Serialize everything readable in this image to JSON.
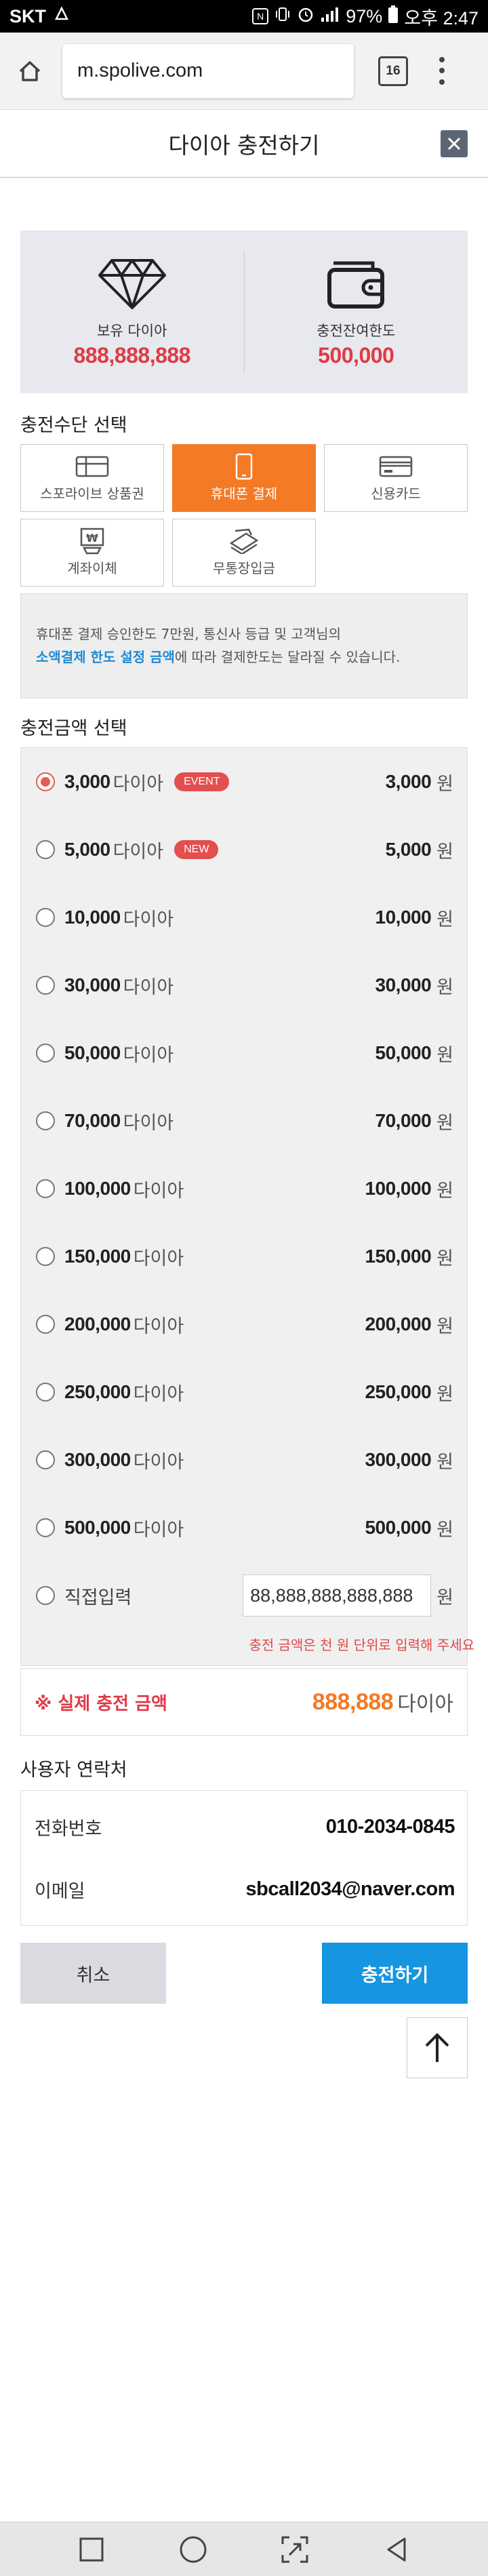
{
  "status_bar": {
    "carrier": "SKT",
    "battery": "97%",
    "time": "오후 2:47"
  },
  "browser": {
    "url": "m.spolive.com",
    "tab_count": "16"
  },
  "page": {
    "title": "다이아 충전하기"
  },
  "balance": {
    "diamond_label": "보유 다이아",
    "diamond_value": "888,888,888",
    "limit_label": "충전잔여한도",
    "limit_value": "500,000"
  },
  "payment": {
    "section_title": "충전수단 선택",
    "methods": [
      {
        "label": "스포라이브 상품권",
        "icon": "gift-card-icon",
        "active": false
      },
      {
        "label": "휴대폰 결제",
        "icon": "mobile-phone-icon",
        "active": true
      },
      {
        "label": "신용카드",
        "icon": "credit-card-icon",
        "active": false
      },
      {
        "label": "계좌이체",
        "icon": "bank-transfer-icon",
        "active": false
      },
      {
        "label": "무통장입금",
        "icon": "cash-deposit-icon",
        "active": false
      }
    ],
    "notice_line1": "휴대폰 결제 승인한도 7만원, 통신사 등급 및 고객님의",
    "notice_link": "소액결제 한도 설정 금액",
    "notice_line2": "에 따라 결제한도는 달라질 수 있습니다."
  },
  "amount": {
    "section_title": "충전금액 선택",
    "unit": "다이아",
    "won": "원",
    "options": [
      {
        "diamonds": "3,000",
        "price": "3,000",
        "badge": "EVENT",
        "selected": true
      },
      {
        "diamonds": "5,000",
        "price": "5,000",
        "badge": "NEW",
        "selected": false
      },
      {
        "diamonds": "10,000",
        "price": "10,000",
        "badge": "",
        "selected": false
      },
      {
        "diamonds": "30,000",
        "price": "30,000",
        "badge": "",
        "selected": false
      },
      {
        "diamonds": "50,000",
        "price": "50,000",
        "badge": "",
        "selected": false
      },
      {
        "diamonds": "70,000",
        "price": "70,000",
        "badge": "",
        "selected": false
      },
      {
        "diamonds": "100,000",
        "price": "100,000",
        "badge": "",
        "selected": false
      },
      {
        "diamonds": "150,000",
        "price": "150,000",
        "badge": "",
        "selected": false
      },
      {
        "diamonds": "200,000",
        "price": "200,000",
        "badge": "",
        "selected": false
      },
      {
        "diamonds": "250,000",
        "price": "250,000",
        "badge": "",
        "selected": false
      },
      {
        "diamonds": "300,000",
        "price": "300,000",
        "badge": "",
        "selected": false
      },
      {
        "diamonds": "500,000",
        "price": "500,000",
        "badge": "",
        "selected": false
      }
    ],
    "direct_label": "직접입력",
    "direct_value": "88,888,888,888,888",
    "direct_hint": "충전 금액은 천 원 단위로 입력해 주세요"
  },
  "actual": {
    "label": "※ 실제 충전 금액",
    "value": "888,888",
    "unit": "다이아"
  },
  "contact": {
    "section_title": "사용자 연락처",
    "phone_label": "전화번호",
    "phone_value": "010-2034-0845",
    "email_label": "이메일",
    "email_value": "sbcall2034@naver.com"
  },
  "actions": {
    "cancel": "취소",
    "charge": "충전하기"
  },
  "colors": {
    "accent_orange": "#f47a25",
    "price_red": "#e03a46",
    "button_blue": "#1695e1"
  }
}
